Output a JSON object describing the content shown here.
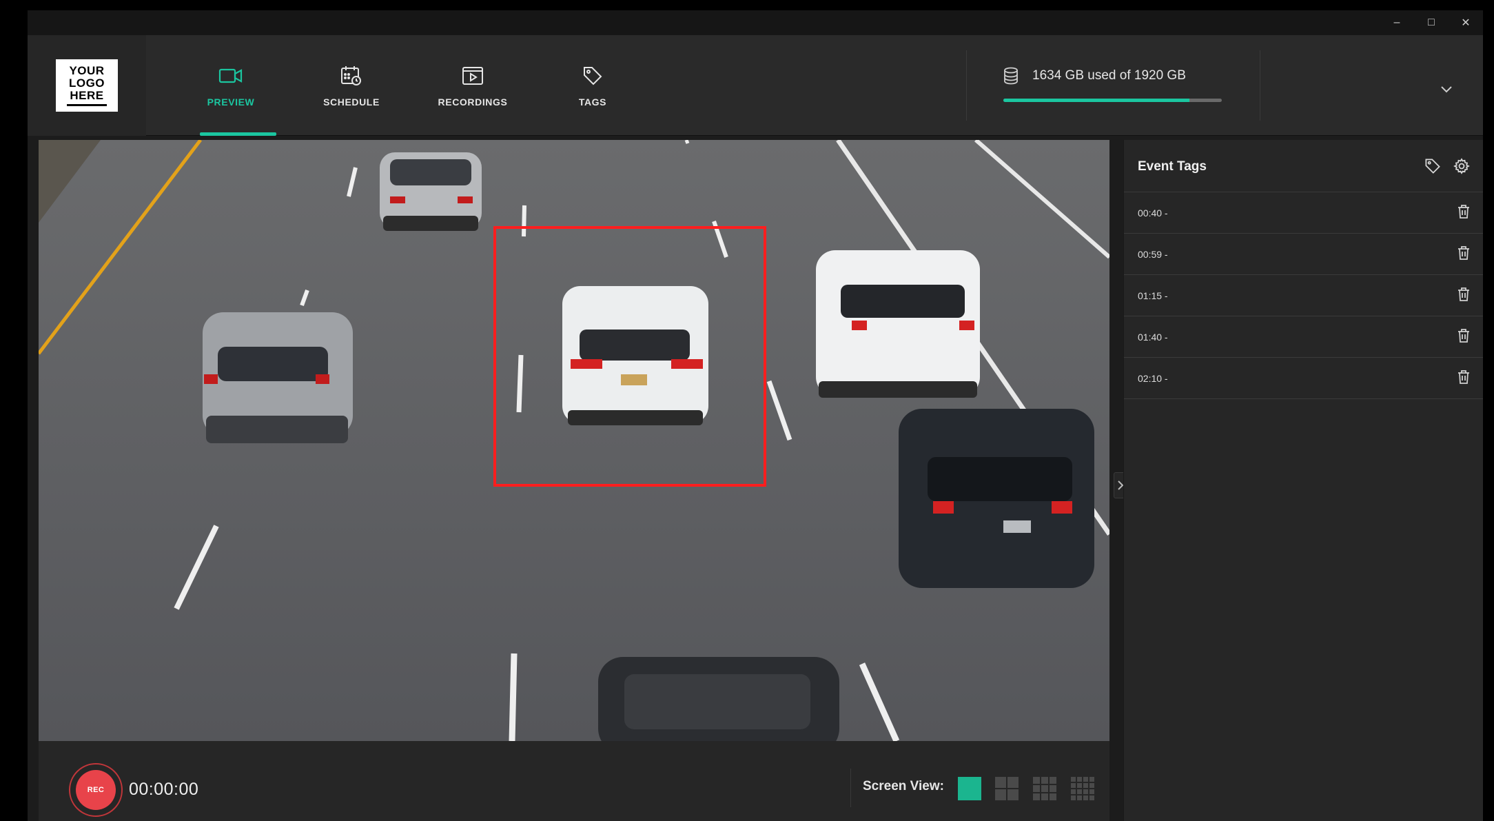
{
  "window": {
    "controls": {
      "minimize": "–",
      "maximize": "□",
      "close": "✕"
    }
  },
  "logo": {
    "line1": "YOUR",
    "line2": "LOGO",
    "line3": "HERE"
  },
  "nav": [
    {
      "label": "PREVIEW",
      "icon": "video-camera-icon",
      "active": true
    },
    {
      "label": "SCHEDULE",
      "icon": "calendar-clock-icon",
      "active": false
    },
    {
      "label": "RECORDINGS",
      "icon": "play-window-icon",
      "active": false
    },
    {
      "label": "TAGS",
      "icon": "tag-icon",
      "active": false
    }
  ],
  "storage": {
    "text": "1634 GB used of 1920 GB",
    "used_gb": 1634,
    "total_gb": 1920,
    "icon": "database-icon"
  },
  "controls": {
    "rec_label": "REC",
    "timer": "00:00:00",
    "screen_view_label": "Screen View:",
    "screen_view_options": [
      "1x1",
      "2x2",
      "3x3",
      "4x4"
    ],
    "screen_view_selected": "1x1"
  },
  "panel": {
    "title": "Event Tags",
    "tags": [
      {
        "time": "00:40 -"
      },
      {
        "time": "00:59 -"
      },
      {
        "time": "01:15 -"
      },
      {
        "time": "01:40 -"
      },
      {
        "time": "02:10 -"
      }
    ]
  },
  "colors": {
    "accent": "#1bc6a0",
    "rec": "#e8434a",
    "detection_box": "#ff1e1e",
    "background": "#1c1c1c",
    "panel": "#262626"
  }
}
